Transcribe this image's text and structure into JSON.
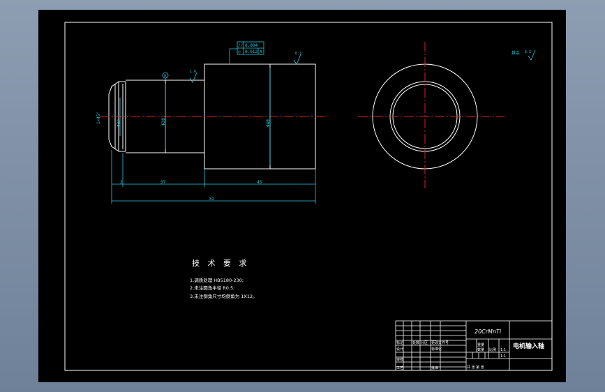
{
  "drawing": {
    "roughness_note": "其余",
    "roughness_value": "6.3",
    "tech_title": "技 术 要 求",
    "tech_items": [
      "1.调质处理 HB5180-230;",
      "2.未注圆角半径 R0.5;",
      "3.未注倒角尺寸均倒角为    1X12。"
    ],
    "dims": {
      "chamfer": "1×45°",
      "d1": "Φ30",
      "d2": "Φ32",
      "d3": "Φ40",
      "len_2": "2",
      "len_37": "37",
      "len_45": "45",
      "len_82": "82",
      "fcf_row1_sym": "//",
      "fcf_row1_val": "0.004",
      "fcf_row2_sym": "○",
      "fcf_row2_val": "0.012",
      "fcf_datum": "A",
      "rough_a": "1.6",
      "rough_b": "6.3",
      "datum_tag": "A"
    },
    "title_block": {
      "material": "20CrMnTi",
      "part_name": "电机输入轴",
      "scale_label": "比例",
      "scale_value": "1:1",
      "qty_label": "数量",
      "qty_value": "1",
      "sheet_label": "共 张 第 张",
      "r1": [
        "标记",
        "处数",
        "分区",
        "更改文件号"
      ],
      "r2": [
        "设计",
        "",
        "标准化"
      ],
      "r3": [
        "审核"
      ],
      "r4": [
        "工艺",
        "",
        "批准"
      ],
      "sign": "阶段标记",
      "weight": "重量",
      "cnt": "1:1"
    }
  }
}
